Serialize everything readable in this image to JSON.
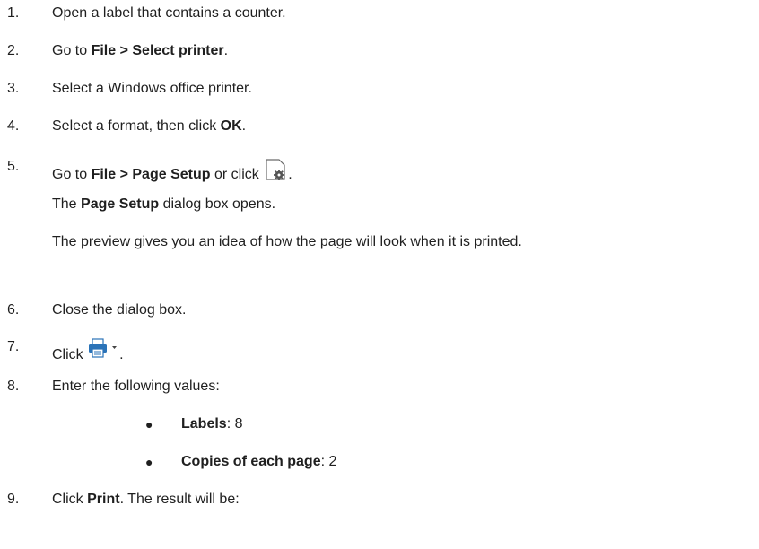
{
  "steps": {
    "s1": {
      "num": "1.",
      "text": "Open a label that contains a counter."
    },
    "s2": {
      "num": "2.",
      "pre": "Go to ",
      "bold": "File > Select printer",
      "post": "."
    },
    "s3": {
      "num": "3.",
      "text": "Select a Windows office printer."
    },
    "s4": {
      "num": "4.",
      "pre": "Select a format, then click ",
      "bold": "OK",
      "post": "."
    },
    "s5": {
      "num": "5.",
      "pre": "Go to ",
      "bold": "File > Page Setup",
      "mid": " or click ",
      "post": ".",
      "sub1_bold": "Page Setup",
      "sub1_post": " dialog box opens.",
      "sub1_pre": "The ",
      "sub2": "The preview gives you an idea of how the page will look when it is printed.",
      "icon": "page-setup-icon"
    },
    "s6": {
      "num": "6.",
      "text": "Close the dialog box."
    },
    "s7": {
      "num": "7.",
      "pre": "Click ",
      "post": ".",
      "icon": "printer-dropdown-icon"
    },
    "s8": {
      "num": "8.",
      "text": "Enter the following values:",
      "bullets": [
        {
          "label": "Labels",
          "value": ": 8"
        },
        {
          "label": "Copies of each page",
          "value": ": 2"
        }
      ]
    },
    "s9": {
      "num": "9.",
      "pre": "Click ",
      "bold": "Print",
      "post": ". The result will be:"
    }
  }
}
